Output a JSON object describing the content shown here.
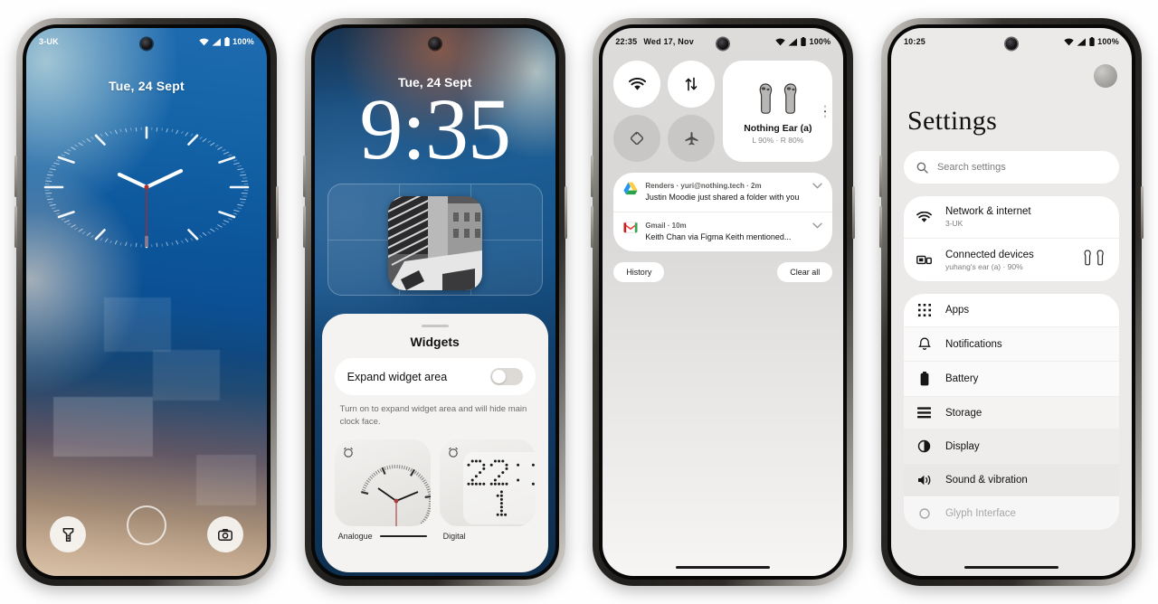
{
  "phone1": {
    "status": {
      "carrier": "3-UK",
      "battery": "100%"
    },
    "lock": {
      "date": "Tue, 24 Sept",
      "clock_type": "analogue",
      "hour_angle": 278,
      "minute_angle": 62,
      "second_angle": 180
    },
    "shortcuts": {
      "left": "flashlight-shortcut",
      "right": "camera-shortcut"
    },
    "fingerprint_label": "fingerprint-sensor"
  },
  "phone2": {
    "lock": {
      "date": "Tue, 24 Sept",
      "time": "9:35"
    },
    "sheet": {
      "title": "Widgets",
      "toggle_label": "Expand widget area",
      "toggle_state": "off",
      "description": "Turn on to expand widget area and will hide main clock face.",
      "widgets": [
        {
          "label": "Analogue",
          "kind": "analogue-clock-widget"
        },
        {
          "label": "Digital",
          "kind": "digital-clock-widget",
          "display": "22:1"
        }
      ]
    }
  },
  "phone3": {
    "status": {
      "time": "22:35",
      "date": "Wed 17, Nov",
      "battery": "100%"
    },
    "quick_settings": [
      {
        "name": "wifi",
        "state": "on"
      },
      {
        "name": "mobile-data",
        "state": "on"
      },
      {
        "name": "auto-rotate",
        "state": "off"
      },
      {
        "name": "airplane-mode",
        "state": "off"
      }
    ],
    "media": {
      "device": "Nothing Ear (a)",
      "battery": "L 90% · R 80%",
      "pages": 3,
      "active_page": 2
    },
    "notifications": [
      {
        "app": "drive-icon",
        "meta": "Renders · yuri@nothing.tech · 2m",
        "body": "Justin Moodie just shared a folder with you"
      },
      {
        "app": "gmail-icon",
        "meta": "Gmail · 10m",
        "body": "Keith Chan via Figma Keith mentioned..."
      }
    ],
    "actions": {
      "history": "History",
      "clear_all": "Clear all"
    }
  },
  "phone4": {
    "status": {
      "time": "10:25",
      "battery": "100%"
    },
    "title": "Settings",
    "search_placeholder": "Search settings",
    "groups": [
      [
        {
          "icon": "wifi-icon",
          "label": "Network & internet",
          "sub": "3-UK"
        },
        {
          "icon": "connected-devices-icon",
          "label": "Connected devices",
          "sub": "yuhang's ear (a) · 90%",
          "trailing": "earbuds-icon"
        }
      ],
      [
        {
          "icon": "apps-grid-icon",
          "label": "Apps"
        },
        {
          "icon": "bell-icon",
          "label": "Notifications"
        },
        {
          "icon": "battery-icon",
          "label": "Battery"
        },
        {
          "icon": "storage-icon",
          "label": "Storage"
        },
        {
          "icon": "display-icon",
          "label": "Display"
        },
        {
          "icon": "sound-icon",
          "label": "Sound & vibration"
        },
        {
          "icon": "glyph-icon",
          "label": "Glyph Interface"
        }
      ]
    ]
  },
  "colors": {
    "accent_blue": "#1564a8",
    "second_hand_red": "#b03030",
    "sheet_bg": "#f4f3f1",
    "shade_bg": "#dedcda",
    "settings_bg": "#eceae8"
  }
}
